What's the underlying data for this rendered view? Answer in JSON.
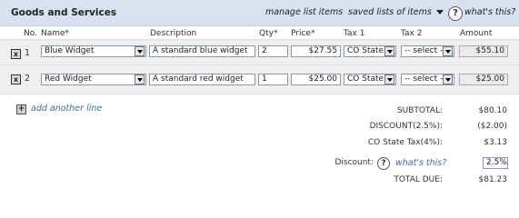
{
  "header": {
    "title": "Goods and Services",
    "manage_link": "manage list items",
    "saved_lists": "saved lists of items",
    "help": "?",
    "whats_this": "what's this?"
  },
  "columns": {
    "no": "No.",
    "name": "Name*",
    "description": "Description",
    "qty": "Qty*",
    "price": "Price*",
    "tax1": "Tax 1",
    "tax2": "Tax 2",
    "amount": "Amount"
  },
  "rows": [
    {
      "remove": "x",
      "num": "1",
      "name": "Blue Widget",
      "description": "A standard blue widget",
      "qty": "2",
      "price": "$27.55",
      "tax1": "CO State T",
      "tax2": "-- select --",
      "amount": "$55.10"
    },
    {
      "remove": "x",
      "num": "2",
      "name": "Red Widget",
      "description": "A standard red widget",
      "qty": "1",
      "price": "$25.00",
      "tax1": "CO State T",
      "tax2": "-- select --",
      "amount": "$25.00"
    }
  ],
  "add_line": {
    "icon": "+",
    "label": "add another line"
  },
  "totals": {
    "subtotal_label": "SUBTOTAL:",
    "subtotal": "$80.10",
    "discount_label": "DISCOUNT(2.5%):",
    "discount": "($2.00)",
    "tax_label": "CO State Tax(4%):",
    "tax": "$3.13",
    "discount_input_label": "Discount:",
    "help": "?",
    "whats_this": "what's this?",
    "discount_input": "2.5%",
    "total_label": "TOTAL DUE:",
    "total": "$81.23"
  }
}
